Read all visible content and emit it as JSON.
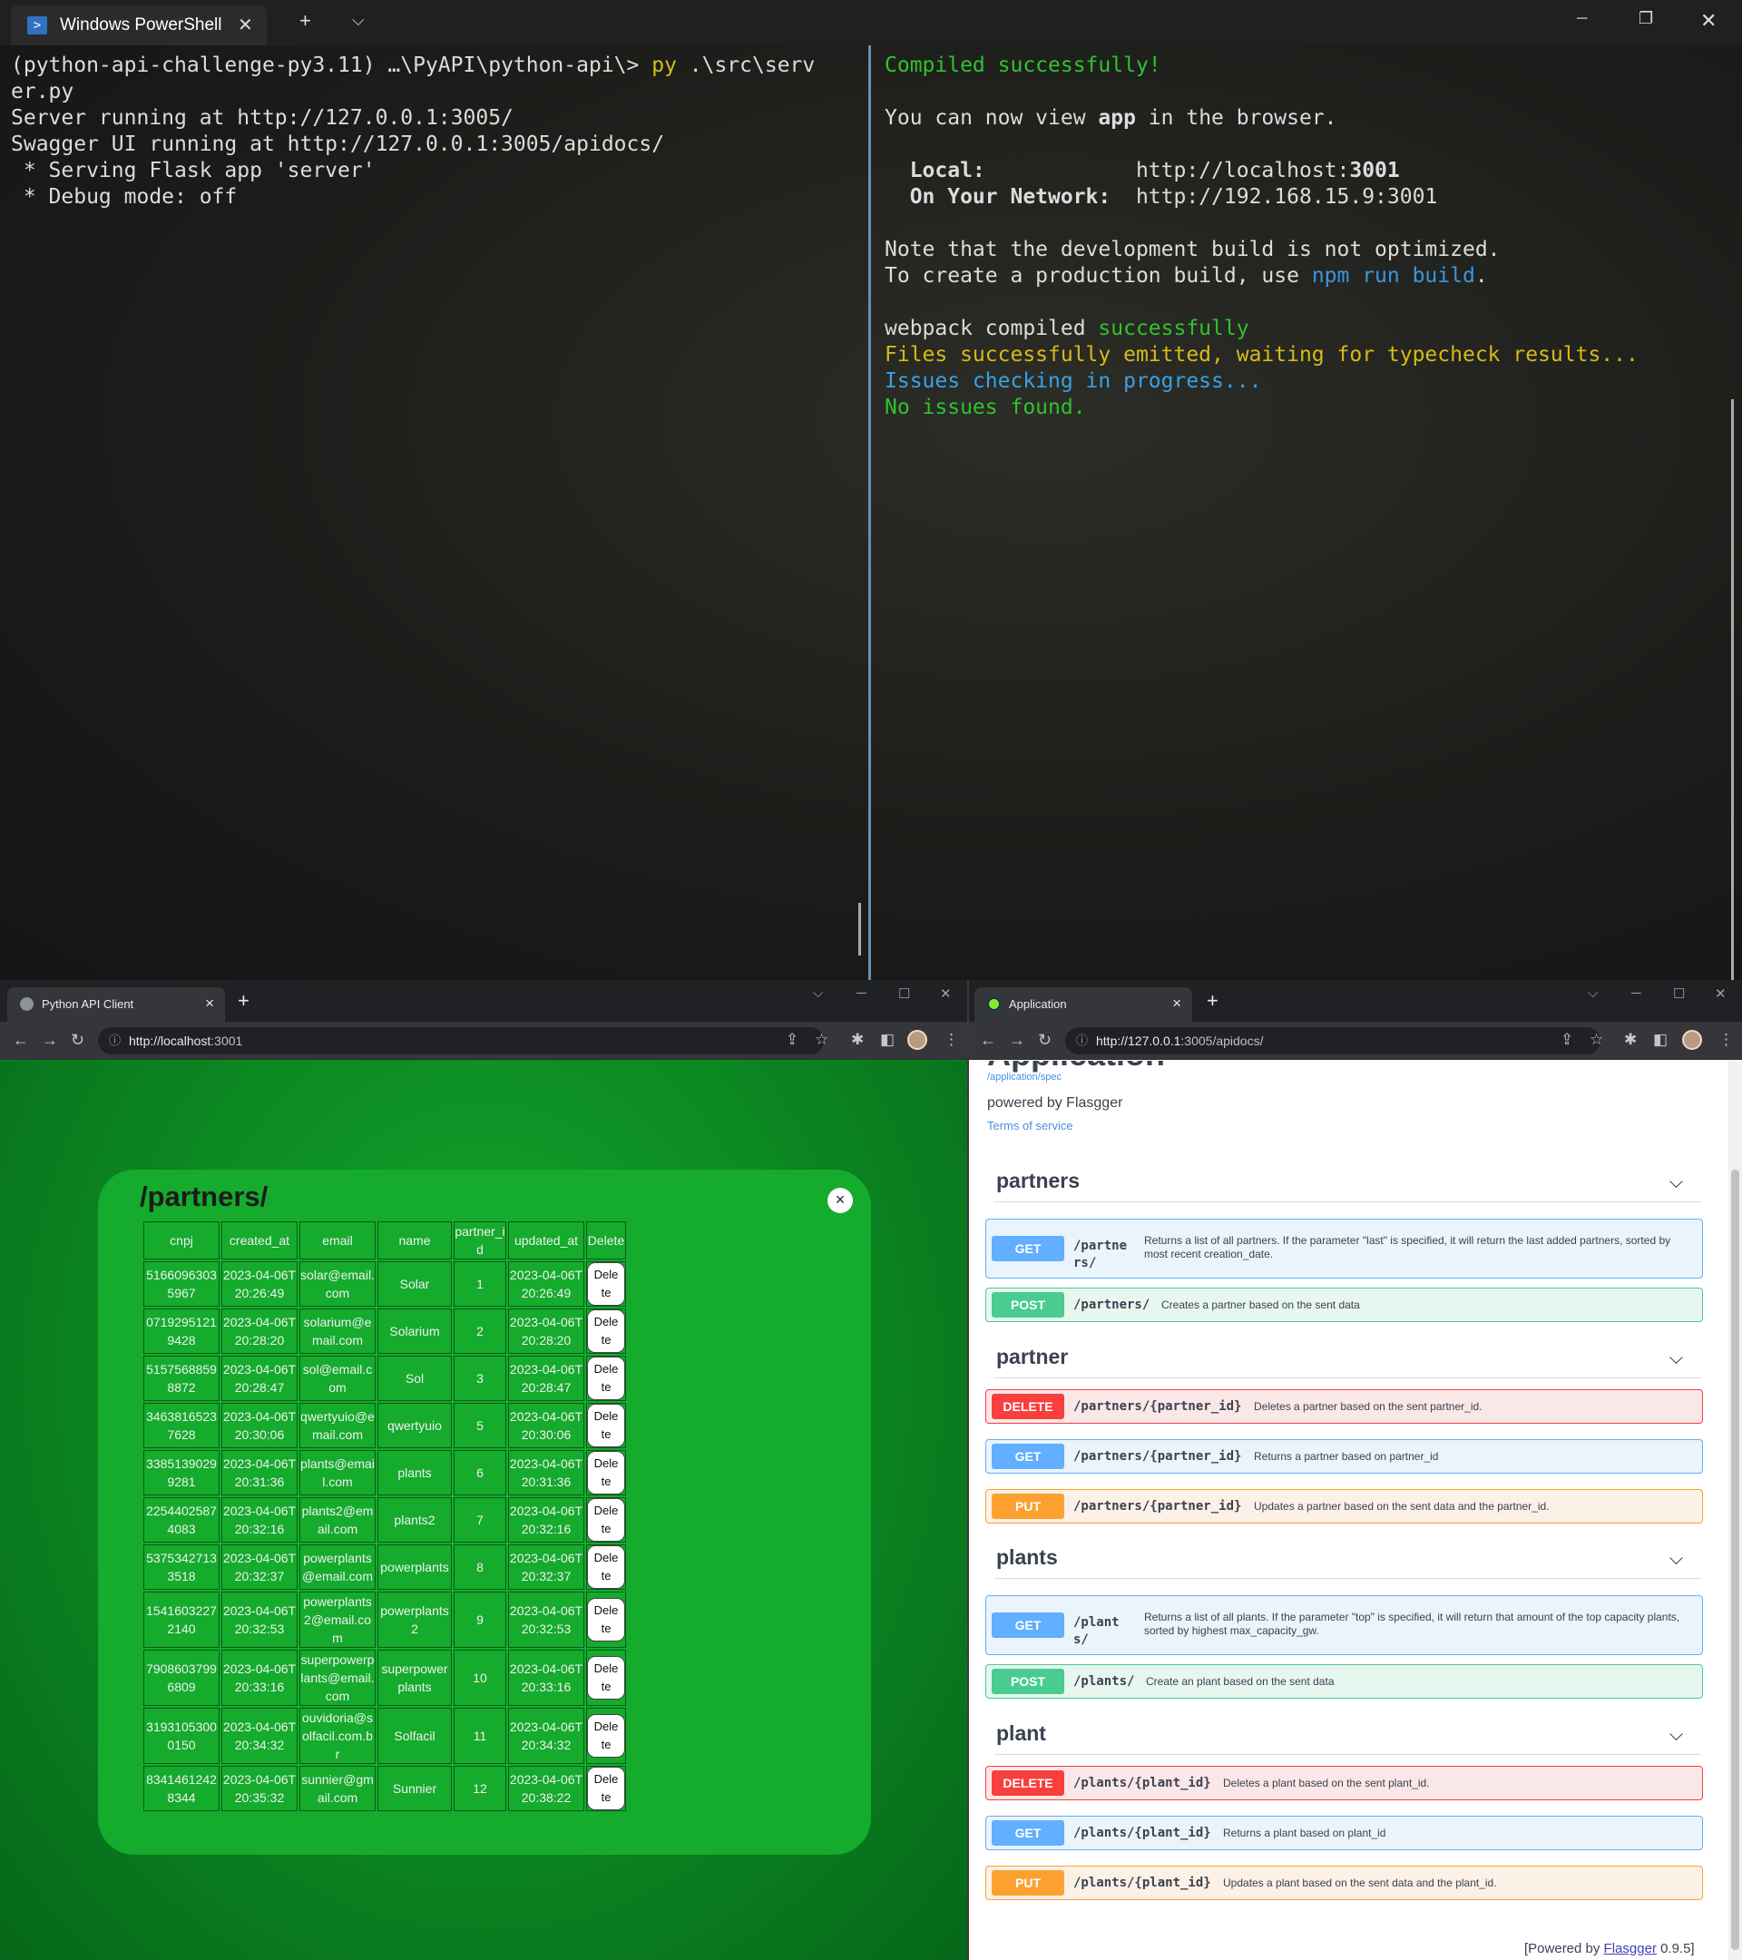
{
  "terminal": {
    "tab_title": "Windows PowerShell",
    "tab_close": "✕",
    "new_tab": "+",
    "dropdown": "⌵",
    "minimize": "─",
    "maximize": "❐",
    "close": "✕",
    "left": {
      "l1_prompt": "(python-api-challenge-py3.11) …\\PyAPI\\python-api\\> ",
      "l1_cmd": "py",
      "l1_arg": " .\\src\\serv",
      "l2": "er.py",
      "l3": "Server running at http://127.0.0.1:3005/",
      "l4": "Swagger UI running at http://127.0.0.1:3005/apidocs/",
      "l5": " * Serving Flask app 'server'",
      "l6": " * Debug mode: off"
    },
    "right": {
      "compiled": "Compiled successfully!",
      "view_pre": "You can now view ",
      "view_app": "app",
      "view_post": " in the browser.",
      "local_label": "  Local:            ",
      "local_url_pre": "http://localhost:",
      "local_port": "3001",
      "network_label": "  On Your Network:  ",
      "network_url": "http://192.168.15.9:3001",
      "note": "Note that the development build is not optimized.",
      "create_pre": "To create a production build, use ",
      "create_cmd": "npm run build",
      "create_post": ".",
      "webpack_pre": "webpack compiled ",
      "webpack_ok": "successfully",
      "files": "Files successfully emitted, waiting for typecheck results...",
      "issues": "Issues checking in progress...",
      "no_issues": "No issues found."
    }
  },
  "browser_left": {
    "tab_title": "Python API Client",
    "url_host": "http://localhost",
    "url_rest": ":3001",
    "info_icon": "ⓘ",
    "card_title": "/partners/",
    "close_label": "×",
    "columns": [
      "cnpj",
      "created_at",
      "email",
      "name",
      "partner_id",
      "updated_at",
      "Delete"
    ],
    "delete_label": "Delete",
    "rows": [
      {
        "cnpj": "51660963035967",
        "created_at": "2023-04-06T20:26:49",
        "email": "solar@email.com",
        "name": "Solar",
        "partner_id": "1",
        "updated_at": "2023-04-06T20:26:49"
      },
      {
        "cnpj": "07192951219428",
        "created_at": "2023-04-06T20:28:20",
        "email": "solarium@email.com",
        "name": "Solarium",
        "partner_id": "2",
        "updated_at": "2023-04-06T20:28:20"
      },
      {
        "cnpj": "51575688598872",
        "created_at": "2023-04-06T20:28:47",
        "email": "sol@email.com",
        "name": "Sol",
        "partner_id": "3",
        "updated_at": "2023-04-06T20:28:47"
      },
      {
        "cnpj": "34638165237628",
        "created_at": "2023-04-06T20:30:06",
        "email": "qwertyuio@email.com",
        "name": "qwertyuio",
        "partner_id": "5",
        "updated_at": "2023-04-06T20:30:06"
      },
      {
        "cnpj": "33851390299281",
        "created_at": "2023-04-06T20:31:36",
        "email": "plants@email.com",
        "name": "plants",
        "partner_id": "6",
        "updated_at": "2023-04-06T20:31:36"
      },
      {
        "cnpj": "22544025874083",
        "created_at": "2023-04-06T20:32:16",
        "email": "plants2@email.com",
        "name": "plants2",
        "partner_id": "7",
        "updated_at": "2023-04-06T20:32:16"
      },
      {
        "cnpj": "53753427133518",
        "created_at": "2023-04-06T20:32:37",
        "email": "powerplants@email.com",
        "name": "powerplants",
        "partner_id": "8",
        "updated_at": "2023-04-06T20:32:37"
      },
      {
        "cnpj": "15416032272140",
        "created_at": "2023-04-06T20:32:53",
        "email": "powerplants2@email.com",
        "name": "powerplants2",
        "partner_id": "9",
        "updated_at": "2023-04-06T20:32:53"
      },
      {
        "cnpj": "79086037996809",
        "created_at": "2023-04-06T20:33:16",
        "email": "superpowerplants@email.com",
        "name": "superpowerplants",
        "partner_id": "10",
        "updated_at": "2023-04-06T20:33:16"
      },
      {
        "cnpj": "31931053000150",
        "created_at": "2023-04-06T20:34:32",
        "email": "ouvidoria@solfacil.com.br",
        "name": "Solfacil",
        "partner_id": "11",
        "updated_at": "2023-04-06T20:34:32"
      },
      {
        "cnpj": "83414612428344",
        "created_at": "2023-04-06T20:35:32",
        "email": "sunnier@gmail.com",
        "name": "Sunnier",
        "partner_id": "12",
        "updated_at": "2023-04-06T20:38:22"
      }
    ]
  },
  "browser_right": {
    "tab_title": "Application",
    "url_host": "http://127.0.0.1",
    "url_rest": ":3005/apidocs/",
    "app_title": "Application",
    "spec_link": "/application/spec",
    "powered": "powered by Flasgger",
    "terms": "Terms of service",
    "footer_pre": "[Powered by ",
    "footer_link": "Flasgger",
    "footer_post": " 0.9.5]",
    "groups": [
      {
        "name": "partners",
        "ops": [
          {
            "method": "GET",
            "path": "/partners/",
            "desc": "Returns a list of all partners. If the parameter \"last\" is specified, it will return the last added partners, sorted by most recent creation_date."
          },
          {
            "method": "POST",
            "path": "/partners/",
            "desc": "Creates a partner based on the sent data"
          }
        ]
      },
      {
        "name": "partner",
        "ops": [
          {
            "method": "DELETE",
            "path": "/partners/{partner_id}",
            "desc": "Deletes a partner based on the sent partner_id."
          },
          {
            "method": "GET",
            "path": "/partners/{partner_id}",
            "desc": "Returns a partner based on partner_id"
          },
          {
            "method": "PUT",
            "path": "/partners/{partner_id}",
            "desc": "Updates a partner based on the sent data and the partner_id."
          }
        ]
      },
      {
        "name": "plants",
        "ops": [
          {
            "method": "GET",
            "path": "/plants/",
            "desc": "Returns a list of all plants. If the parameter \"top\" is specified, it will return that amount of the top capacity plants, sorted by highest max_capacity_gw."
          },
          {
            "method": "POST",
            "path": "/plants/",
            "desc": "Create an plant based on the sent data"
          }
        ]
      },
      {
        "name": "plant",
        "ops": [
          {
            "method": "DELETE",
            "path": "/plants/{plant_id}",
            "desc": "Deletes a plant based on the sent plant_id."
          },
          {
            "method": "GET",
            "path": "/plants/{plant_id}",
            "desc": "Returns a plant based on plant_id"
          },
          {
            "method": "PUT",
            "path": "/plants/{plant_id}",
            "desc": "Updates a plant based on the sent data and the plant_id."
          }
        ]
      }
    ]
  },
  "colors": {
    "method_get": "#61affe",
    "method_post": "#49cc90",
    "method_delete": "#f93e3e",
    "method_put": "#fca130",
    "app_bg": "#0b8a1f"
  },
  "icons": [
    "powershell-icon",
    "back-icon",
    "forward-icon",
    "reload-icon",
    "share-icon",
    "star-icon",
    "extensions-icon",
    "sidepanel-icon",
    "menu-icon",
    "chevron-down-icon",
    "close-icon"
  ]
}
